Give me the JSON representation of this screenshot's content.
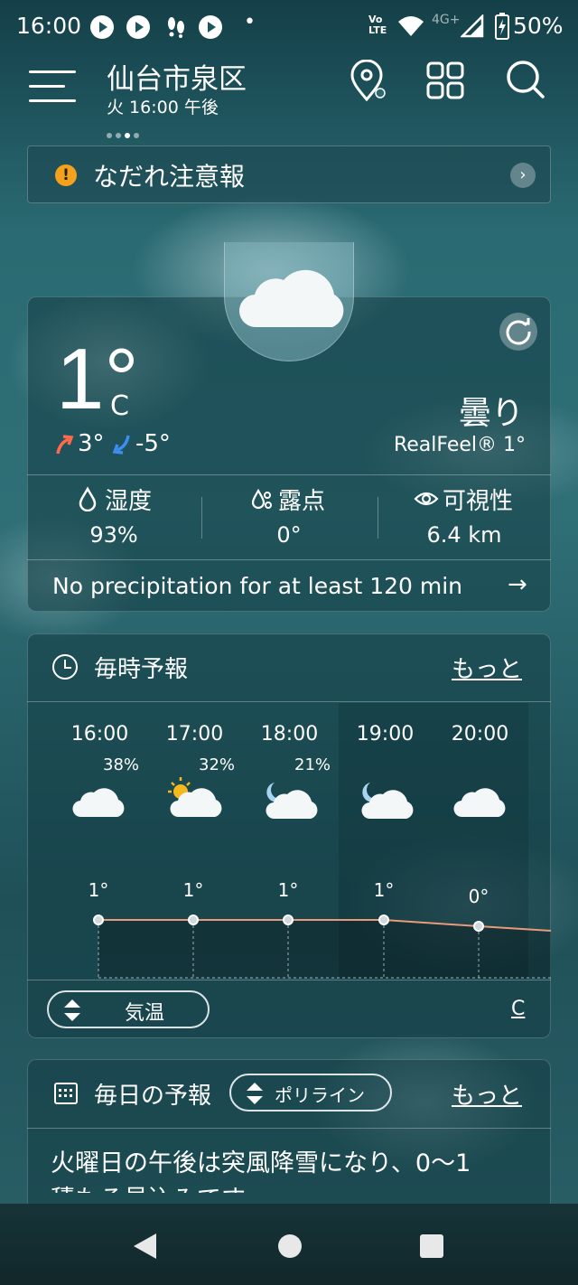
{
  "status_bar": {
    "time": "16:00",
    "dot": "•",
    "network": "4G+",
    "volte": "Vo LTE",
    "battery": "50%"
  },
  "header": {
    "city": "仙台市泉区",
    "datetime": "火 16:00 午後"
  },
  "alert": {
    "text": "なだれ注意報",
    "accent": "#f4a11d"
  },
  "current": {
    "temperature": "1°",
    "unit": "C",
    "high": "3°",
    "low": "-5°",
    "condition": "曇り",
    "realfeel": "RealFeel® 1°",
    "metrics": [
      {
        "label": "湿度",
        "value": "93%",
        "icon": "humidity-icon"
      },
      {
        "label": "露点",
        "value": "0°",
        "icon": "dew-point-icon"
      },
      {
        "label": "可視性",
        "value": "6.4 km",
        "icon": "eye-icon"
      }
    ],
    "precipitation": "No precipitation for at least 120 min"
  },
  "hourly": {
    "title": "毎時予報",
    "more": "もっと",
    "hours": [
      {
        "time": "16:00",
        "precip": "38%",
        "icon": "cloud-icon",
        "temp": "1°",
        "value": 1
      },
      {
        "time": "17:00",
        "precip": "32%",
        "icon": "partly-sunny-icon",
        "temp": "1°",
        "value": 1
      },
      {
        "time": "18:00",
        "precip": "21%",
        "icon": "partly-cloudy-night-icon",
        "temp": "1°",
        "value": 1
      },
      {
        "time": "19:00",
        "precip": "",
        "icon": "partly-cloudy-night-icon",
        "temp": "1°",
        "value": 1
      },
      {
        "time": "20:00",
        "precip": "",
        "icon": "cloud-icon",
        "temp": "0°",
        "value": 0
      }
    ],
    "selector": "気温",
    "unit": "C"
  },
  "daily": {
    "title": "毎日の予報",
    "selector": "ポリライン",
    "more": "もっと",
    "summary": "火曜日の午後は突風降雪になり、0〜1",
    "summary_line2": "積もる見込みです"
  }
}
